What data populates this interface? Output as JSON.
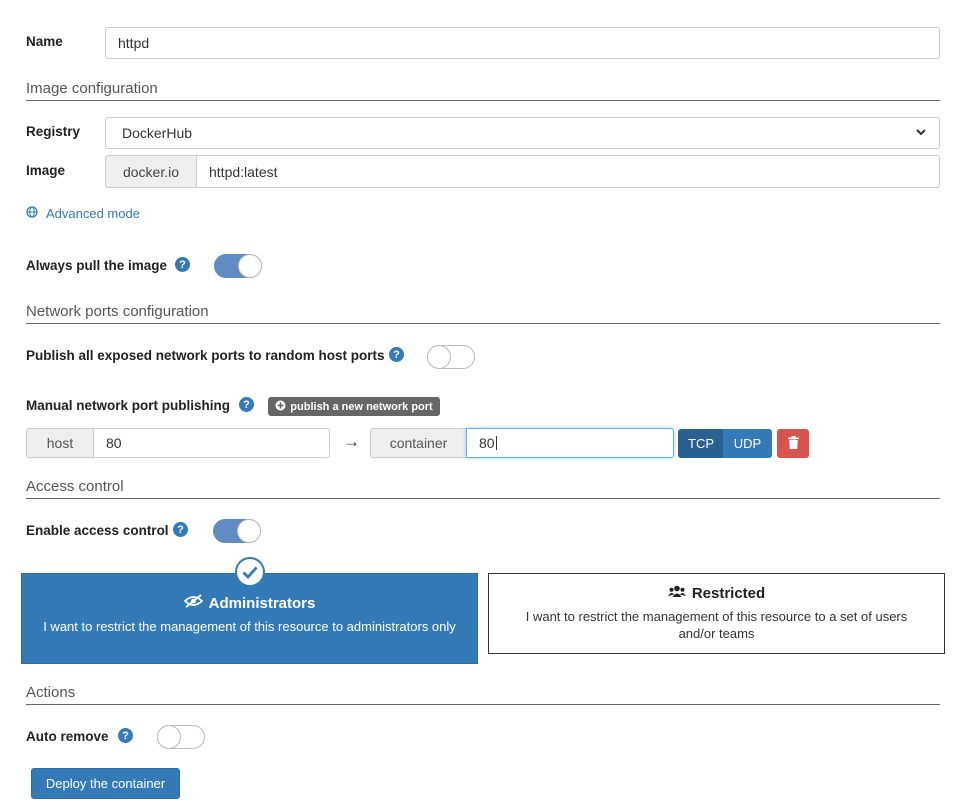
{
  "name": {
    "label": "Name",
    "value": "httpd"
  },
  "image_config": {
    "section": "Image configuration",
    "registry_label": "Registry",
    "registry_value": "DockerHub",
    "image_label": "Image",
    "image_prefix": "docker.io",
    "image_value": "httpd:latest",
    "advanced_mode": "Advanced mode"
  },
  "always_pull": {
    "label": "Always pull the image",
    "on": true
  },
  "network": {
    "section": "Network ports configuration",
    "publish_all_label": "Publish all exposed network ports to random host ports",
    "publish_all_on": false,
    "manual_label": "Manual network port publishing",
    "publish_new_button": "publish a new network port",
    "host_label": "host",
    "host_value": "80",
    "container_label": "container",
    "container_value": "80",
    "arrow": "→",
    "tcp": "TCP",
    "udp": "UDP"
  },
  "access": {
    "section": "Access control",
    "enable_label": "Enable access control",
    "enable_on": true,
    "admin_title": "Administrators",
    "admin_desc": "I want to restrict the management of this resource to administrators only",
    "restricted_title": "Restricted",
    "restricted_desc": "I want to restrict the management of this resource to a set of users and/or teams"
  },
  "actions": {
    "section": "Actions",
    "auto_remove_label": "Auto remove",
    "auto_remove_on": false,
    "deploy_button": "Deploy the container"
  },
  "colors": {
    "primary": "#337ab7",
    "primary_dark": "#286090",
    "danger": "#d9534f",
    "toggle_on": "#5f8cc3"
  }
}
